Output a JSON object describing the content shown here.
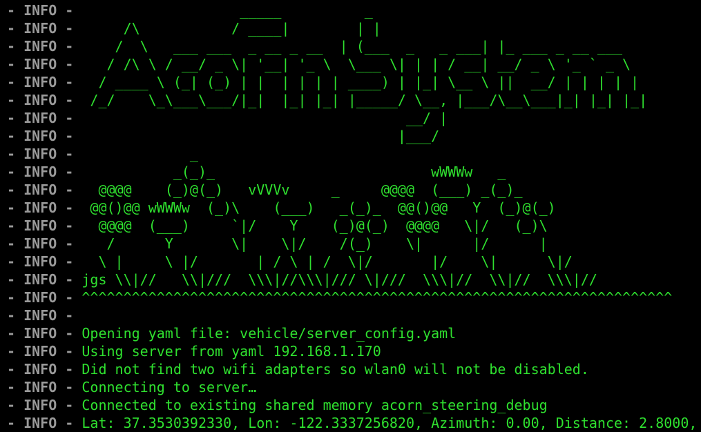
{
  "colors": {
    "background": "#000000",
    "prefix": "#9a9a9a",
    "message": "#2fe02f"
  },
  "log_lines": [
    {
      "prefix": "- INFO - ",
      "text": "                   _____          _"
    },
    {
      "prefix": "- INFO - ",
      "text": "     /\\           / ____|        | |"
    },
    {
      "prefix": "- INFO - ",
      "text": "    /  \\   ___ ___  _ __ _ __  | (___  _   _ ___| |_ ___ _ __ ___"
    },
    {
      "prefix": "- INFO - ",
      "text": "   / /\\ \\ / __/ _ \\| '__| '_ \\  \\___ \\| | | / __| __/ _ \\ '_ ` _ \\"
    },
    {
      "prefix": "- INFO - ",
      "text": "  / ____ \\ (_| (_) | |  | | | | ____) | |_| \\__ \\ ||  __/ | | | | |"
    },
    {
      "prefix": "- INFO - ",
      "text": " /_/    \\_\\___\\___/|_|  |_| |_| |_____/ \\__, |___/\\__\\___|_| |_| |_|"
    },
    {
      "prefix": "- INFO - ",
      "text": "                                       __/ |"
    },
    {
      "prefix": "- INFO - ",
      "text": "                                      |___/"
    },
    {
      "prefix": "- INFO - ",
      "text": "             _"
    },
    {
      "prefix": "- INFO - ",
      "text": "           _(_)_                          wWWWw   _"
    },
    {
      "prefix": "- INFO - ",
      "text": "  @@@@    (_)@(_)   vVVVv     _     @@@@  (___) _(_)_"
    },
    {
      "prefix": "- INFO - ",
      "text": " @@()@@ wWWWw  (_)\\    (___)   _(_)_  @@()@@   Y  (_)@(_)"
    },
    {
      "prefix": "- INFO - ",
      "text": "  @@@@  (___)     `|/    Y    (_)@(_)  @@@@   \\|/   (_)\\"
    },
    {
      "prefix": "- INFO - ",
      "text": "   /      Y       \\|    \\|/    /(_)    \\|      |/      |"
    },
    {
      "prefix": "- INFO - ",
      "text": "  \\ |     \\ |/       | / \\ | /  \\|/       |/    \\|      \\|/"
    },
    {
      "prefix": "- INFO - ",
      "text": "jgs \\\\|//   \\\\|///  \\\\\\|//\\\\\\|/// \\|///  \\\\\\|//  \\\\|//  \\\\\\|//"
    },
    {
      "prefix": "- INFO - ",
      "text": "^^^^^^^^^^^^^^^^^^^^^^^^^^^^^^^^^^^^^^^^^^^^^^^^^^^^^^^^^^^^^^^^^^^^^^^"
    },
    {
      "prefix": "- INFO - ",
      "text": ""
    },
    {
      "prefix": "- INFO - ",
      "text": "Opening yaml file: vehicle/server_config.yaml"
    },
    {
      "prefix": "- INFO - ",
      "text": "Using server from yaml 192.168.1.170"
    },
    {
      "prefix": "- INFO - ",
      "text": "Did not find two wifi adapters so wlan0 will not be disabled."
    },
    {
      "prefix": "- INFO - ",
      "text": "Connecting to server…"
    },
    {
      "prefix": "- INFO - ",
      "text": "Connected to existing shared memory acorn_steering_debug"
    },
    {
      "prefix": "- INFO - ",
      "text": "Lat: 37.3530392330, Lon: -122.3337256820, Azimuth: 0.00, Distance: 2.8000,"
    }
  ]
}
